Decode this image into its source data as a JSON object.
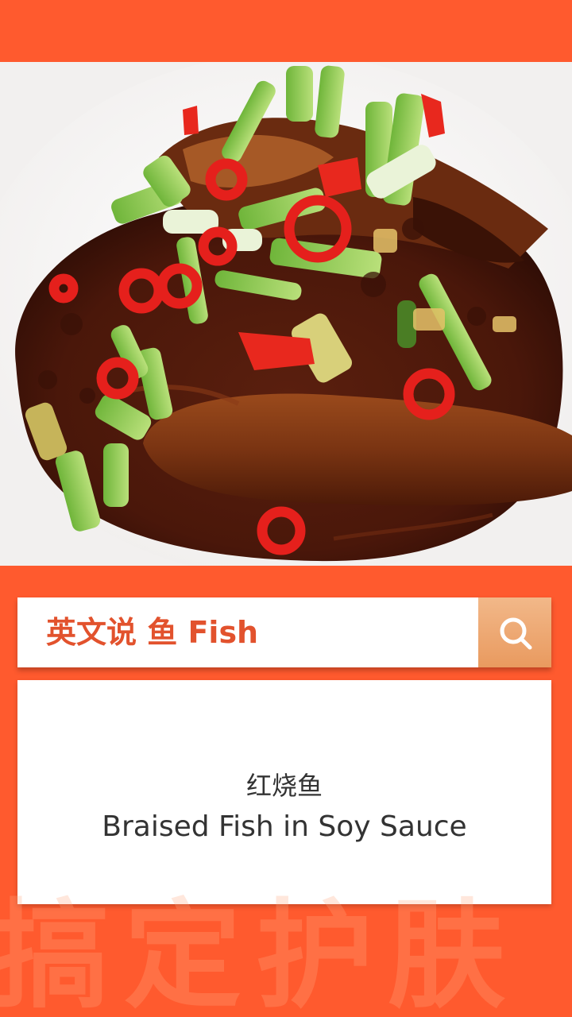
{
  "colors": {
    "background": "#ff5a2e",
    "search_text": "#e2522d",
    "search_button": "#eba46c",
    "card": "#ffffff"
  },
  "photo": {
    "icon": "braised-fish-photo"
  },
  "search": {
    "query": "英文说 鱼 Fish",
    "button_icon": "search-icon"
  },
  "result": {
    "chinese": "红烧鱼",
    "english": "Braised Fish in Soy Sauce"
  },
  "watermark": {
    "text": "搞定护肤"
  }
}
